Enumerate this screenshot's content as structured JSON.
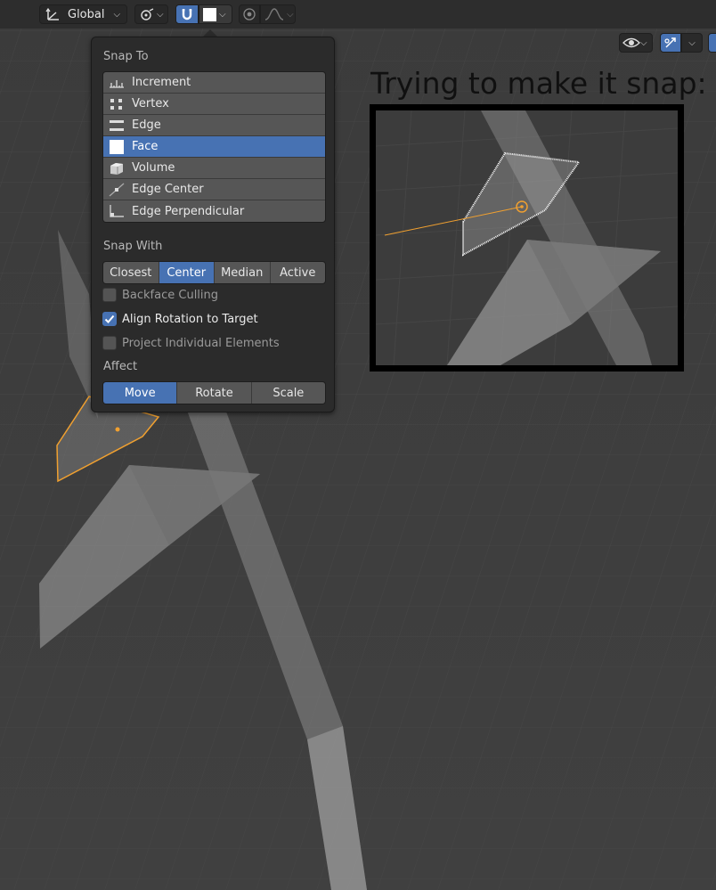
{
  "header": {
    "orientation_label": "Global",
    "icons": {
      "orientation": "transform-orientation-icon",
      "pivot": "pivot-point-icon",
      "snap": "magnet-icon",
      "snap_element": "snap-face-icon",
      "proportional": "proportional-edit-icon",
      "falloff": "falloff-curve-icon",
      "visibility": "eye-icon",
      "gizmo": "gizmo-icon"
    }
  },
  "snap_panel": {
    "snap_to_label": "Snap To",
    "snap_to_items": [
      {
        "label": "Increment",
        "icon": "increment-icon"
      },
      {
        "label": "Vertex",
        "icon": "vertex-icon"
      },
      {
        "label": "Edge",
        "icon": "edge-icon"
      },
      {
        "label": "Face",
        "icon": "face-icon",
        "selected": true
      },
      {
        "label": "Volume",
        "icon": "volume-icon"
      },
      {
        "label": "Edge Center",
        "icon": "edge-center-icon"
      },
      {
        "label": "Edge Perpendicular",
        "icon": "edge-perpendicular-icon"
      }
    ],
    "snap_with_label": "Snap With",
    "snap_with_options": [
      "Closest",
      "Center",
      "Median",
      "Active"
    ],
    "snap_with_selected": "Center",
    "options": [
      {
        "label": "Backface Culling",
        "checked": false,
        "enabled": false
      },
      {
        "label": "Align Rotation to Target",
        "checked": true,
        "enabled": true
      },
      {
        "label": "Project Individual Elements",
        "checked": false,
        "enabled": false
      }
    ],
    "affect_label": "Affect",
    "affect_options": [
      "Move",
      "Rotate",
      "Scale"
    ],
    "affect_selected": "Move"
  },
  "annotation": {
    "title": "Trying to make it snap:"
  },
  "colors": {
    "accent": "#4772b3",
    "panel_bg": "#2b2b2b",
    "viewport_bg": "#3d3d3d",
    "selection_orange": "#f0a030"
  }
}
